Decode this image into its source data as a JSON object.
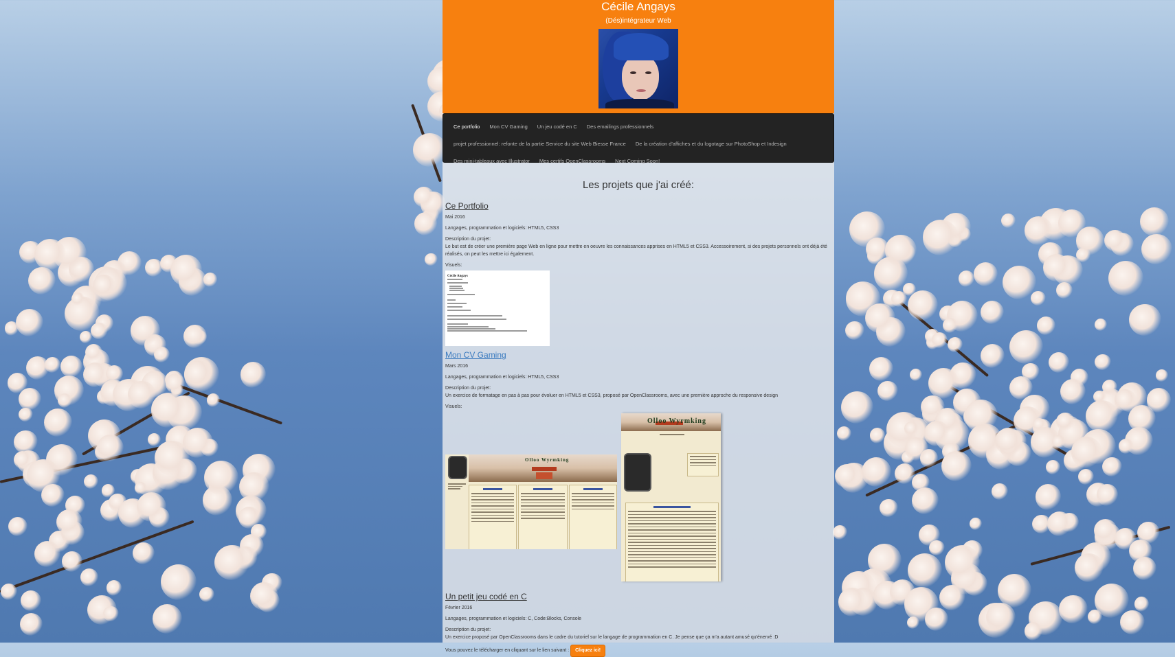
{
  "header": {
    "name": "Cécile Angays",
    "subtitle": "(Dés)intégrateur Web"
  },
  "nav": {
    "items": [
      {
        "label": "Ce portfolio",
        "active": true
      },
      {
        "label": "Mon CV Gaming"
      },
      {
        "label": "Un jeu codé en C"
      },
      {
        "label": "Des emailings professionnels"
      },
      {
        "label": "projet professionnel: refonte de la partie Service du site Web Biesse France"
      },
      {
        "label": "De la création d'affiches et du logotage sur PhotoShop et Indesign"
      },
      {
        "label": "Des mini-tableaux avec Illustrator"
      },
      {
        "label": "Mes certifs OpenClassrooms"
      },
      {
        "label": "Next Coming Soon!"
      }
    ]
  },
  "main": {
    "section_title": "Les projets que j'ai créé:",
    "projects": [
      {
        "title": "Ce Portfolio",
        "date": "Mai 2016",
        "languages": "Langages, programmation et logiciels: HTML5, CSS3",
        "desc_label": "Description du projet:",
        "desc": "Le but est de créer une première page Web en ligne pour mettre en oeuvre les connaissances apprises en HTML5 et CSS3. Accessoirement, si des projets personnels ont déjà été réalisés, on peut les mettre ici également.",
        "visuals_label": "Visuels:",
        "thumb_title": "Cécile Angays"
      },
      {
        "title": "Mon CV Gaming",
        "date": "Mars 2016",
        "languages": "Langages, programmation et logiciels: HTML5, CSS3",
        "desc_label": "Description du projet:",
        "desc": "Un exercice de formatage en pas à pas pour évoluer en HTML5 et CSS3, proposé par OpenClassrooms, avec une première approche du responsive design",
        "visuals_label": "Visuels:",
        "shot_title": "Olloo Wyrmking"
      },
      {
        "title": "Un petit jeu codé en C",
        "date": "Février 2016",
        "languages": "Langages, programmation et logiciels: C, Code:Blocks, Console",
        "desc_label": "Description du projet:",
        "desc": "Un exercice proposé par OpenClassrooms dans le cadre du tutoriel sur le langage de programmation en C. Je pense que ça m'a autant amusé qu'énervé :D",
        "download_text": "Vous pouvez le télécharger en cliquant sur le lien suivant :",
        "download_button": "Cliquez ici!"
      }
    ]
  },
  "colors": {
    "header_bg": "#f7800f",
    "nav_bg": "#232323",
    "link": "#3a7abf"
  },
  "icons": {
    "avatar": "avatar-photo"
  }
}
